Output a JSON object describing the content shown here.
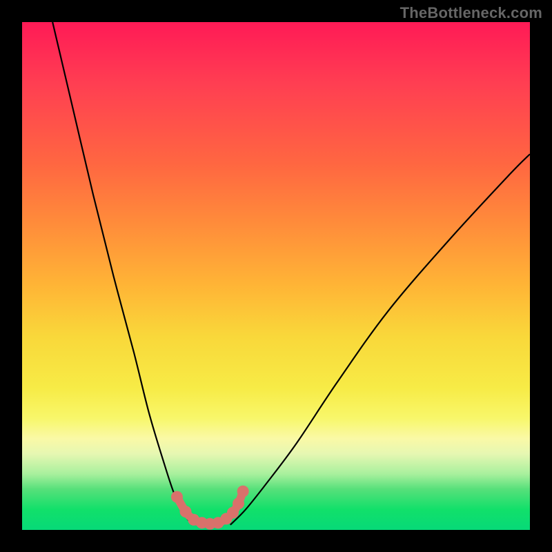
{
  "attribution": "TheBottleneck.com",
  "chart_data": {
    "type": "line",
    "title": "",
    "xlabel": "",
    "ylabel": "",
    "xlim": [
      0,
      100
    ],
    "ylim": [
      0,
      100
    ],
    "grid": false,
    "note": "Axes are unlabeled; values estimated from pixel positions (0–100 each axis, y=0 at bottom).",
    "series": [
      {
        "name": "left-descending-curve",
        "x": [
          6,
          10,
          14,
          18,
          22,
          25,
          28,
          30,
          32,
          33.5
        ],
        "y": [
          100,
          83,
          66,
          50,
          35,
          23,
          13,
          7,
          3,
          1
        ],
        "style": "thin-black"
      },
      {
        "name": "right-ascending-curve",
        "x": [
          41,
          44,
          48,
          54,
          62,
          72,
          84,
          96,
          100
        ],
        "y": [
          1,
          4,
          9,
          17,
          29,
          43,
          57,
          70,
          74
        ],
        "style": "thin-black"
      },
      {
        "name": "valley-markers",
        "x": [
          30.5,
          32.2,
          33.8,
          35.4,
          37.0,
          38.6,
          40.2,
          41.5,
          42.6,
          43.5
        ],
        "y": [
          6.5,
          3.6,
          2.0,
          1.4,
          1.2,
          1.4,
          2.2,
          3.4,
          5.2,
          7.6
        ],
        "style": "salmon-dots-thick"
      }
    ],
    "colors": {
      "curve": "#000000",
      "markers": "#d9716b",
      "gradient_top": "#ff1a56",
      "gradient_bottom": "#07d978"
    }
  }
}
